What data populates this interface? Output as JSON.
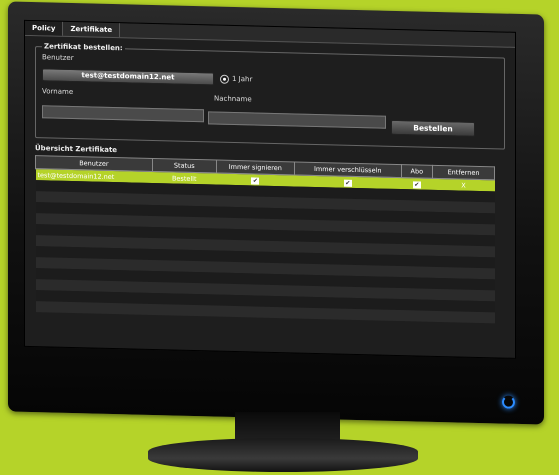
{
  "tabs": [
    {
      "label": "Policy",
      "active": true
    },
    {
      "label": "Zertifikate",
      "active": false
    }
  ],
  "order_group": {
    "legend": "Zertifikat bestellen:",
    "user_label": "Benutzer",
    "user_value": "test@testdomain12.net",
    "duration_option": "1 Jahr",
    "firstname_label": "Vorname",
    "lastname_label": "Nachname",
    "firstname_value": "",
    "lastname_value": "",
    "order_button": "Bestellen"
  },
  "overview": {
    "title": "Übersicht Zertifikate",
    "columns": [
      "Benutzer",
      "Status",
      "Immer signieren",
      "Immer verschlüsseln",
      "Abo",
      "Entfernen"
    ],
    "rows": [
      {
        "user": "test@testdomain12.net",
        "status": "Bestellt",
        "sign": true,
        "encrypt": true,
        "abo": true,
        "remove": "X"
      }
    ]
  },
  "colors": {
    "accent": "#b5d329",
    "power": "#2c8cff"
  }
}
